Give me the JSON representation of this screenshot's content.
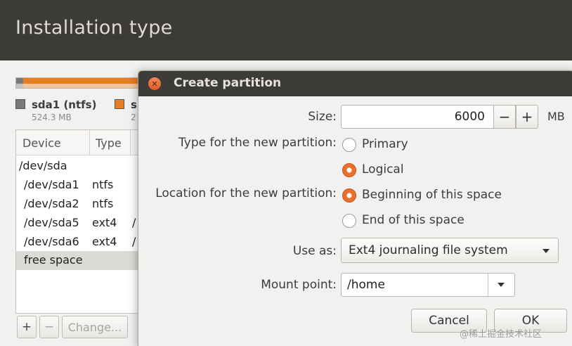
{
  "installer": {
    "title": "Installation type",
    "legend": [
      {
        "name": "sda1 (ntfs)",
        "size": "524.3 MB",
        "color": "#7a7a7a"
      },
      {
        "name": "s",
        "size": "2",
        "color": "#e67e22"
      }
    ],
    "table": {
      "headers": [
        "Device",
        "Type"
      ],
      "rows": [
        {
          "device": "/dev/sda",
          "type": "",
          "extra": ""
        },
        {
          "device": "/dev/sda1",
          "type": "ntfs",
          "extra": ""
        },
        {
          "device": "/dev/sda2",
          "type": "ntfs",
          "extra": ""
        },
        {
          "device": "/dev/sda5",
          "type": "ext4",
          "extra": "/"
        },
        {
          "device": "/dev/sda6",
          "type": "ext4",
          "extra": "/"
        },
        {
          "device": "free space",
          "type": "",
          "extra": "",
          "selected": true
        }
      ]
    },
    "buttons": {
      "add": "+",
      "remove": "−",
      "change": "Change..."
    }
  },
  "dialog": {
    "title": "Create partition",
    "close_icon": "close-icon",
    "size": {
      "label": "Size:",
      "value": "6000",
      "minus": "−",
      "plus": "+",
      "unit": "MB"
    },
    "type": {
      "label": "Type for the new partition:",
      "options": [
        {
          "label": "Primary",
          "selected": false
        },
        {
          "label": "Logical",
          "selected": true
        }
      ]
    },
    "location": {
      "label": "Location for the new partition:",
      "options": [
        {
          "label": "Beginning of this space",
          "selected": true
        },
        {
          "label": "End of this space",
          "selected": false
        }
      ]
    },
    "use_as": {
      "label": "Use as:",
      "value": "Ext4 journaling file system"
    },
    "mount_point": {
      "label": "Mount point:",
      "value": "/home"
    },
    "buttons": {
      "cancel": "Cancel",
      "ok": "OK"
    }
  },
  "watermark": "@稀土掘金技术社区",
  "colors": {
    "accent": "#e9702f",
    "header": "#3c3b37",
    "bar_orange": "#e67e22"
  }
}
